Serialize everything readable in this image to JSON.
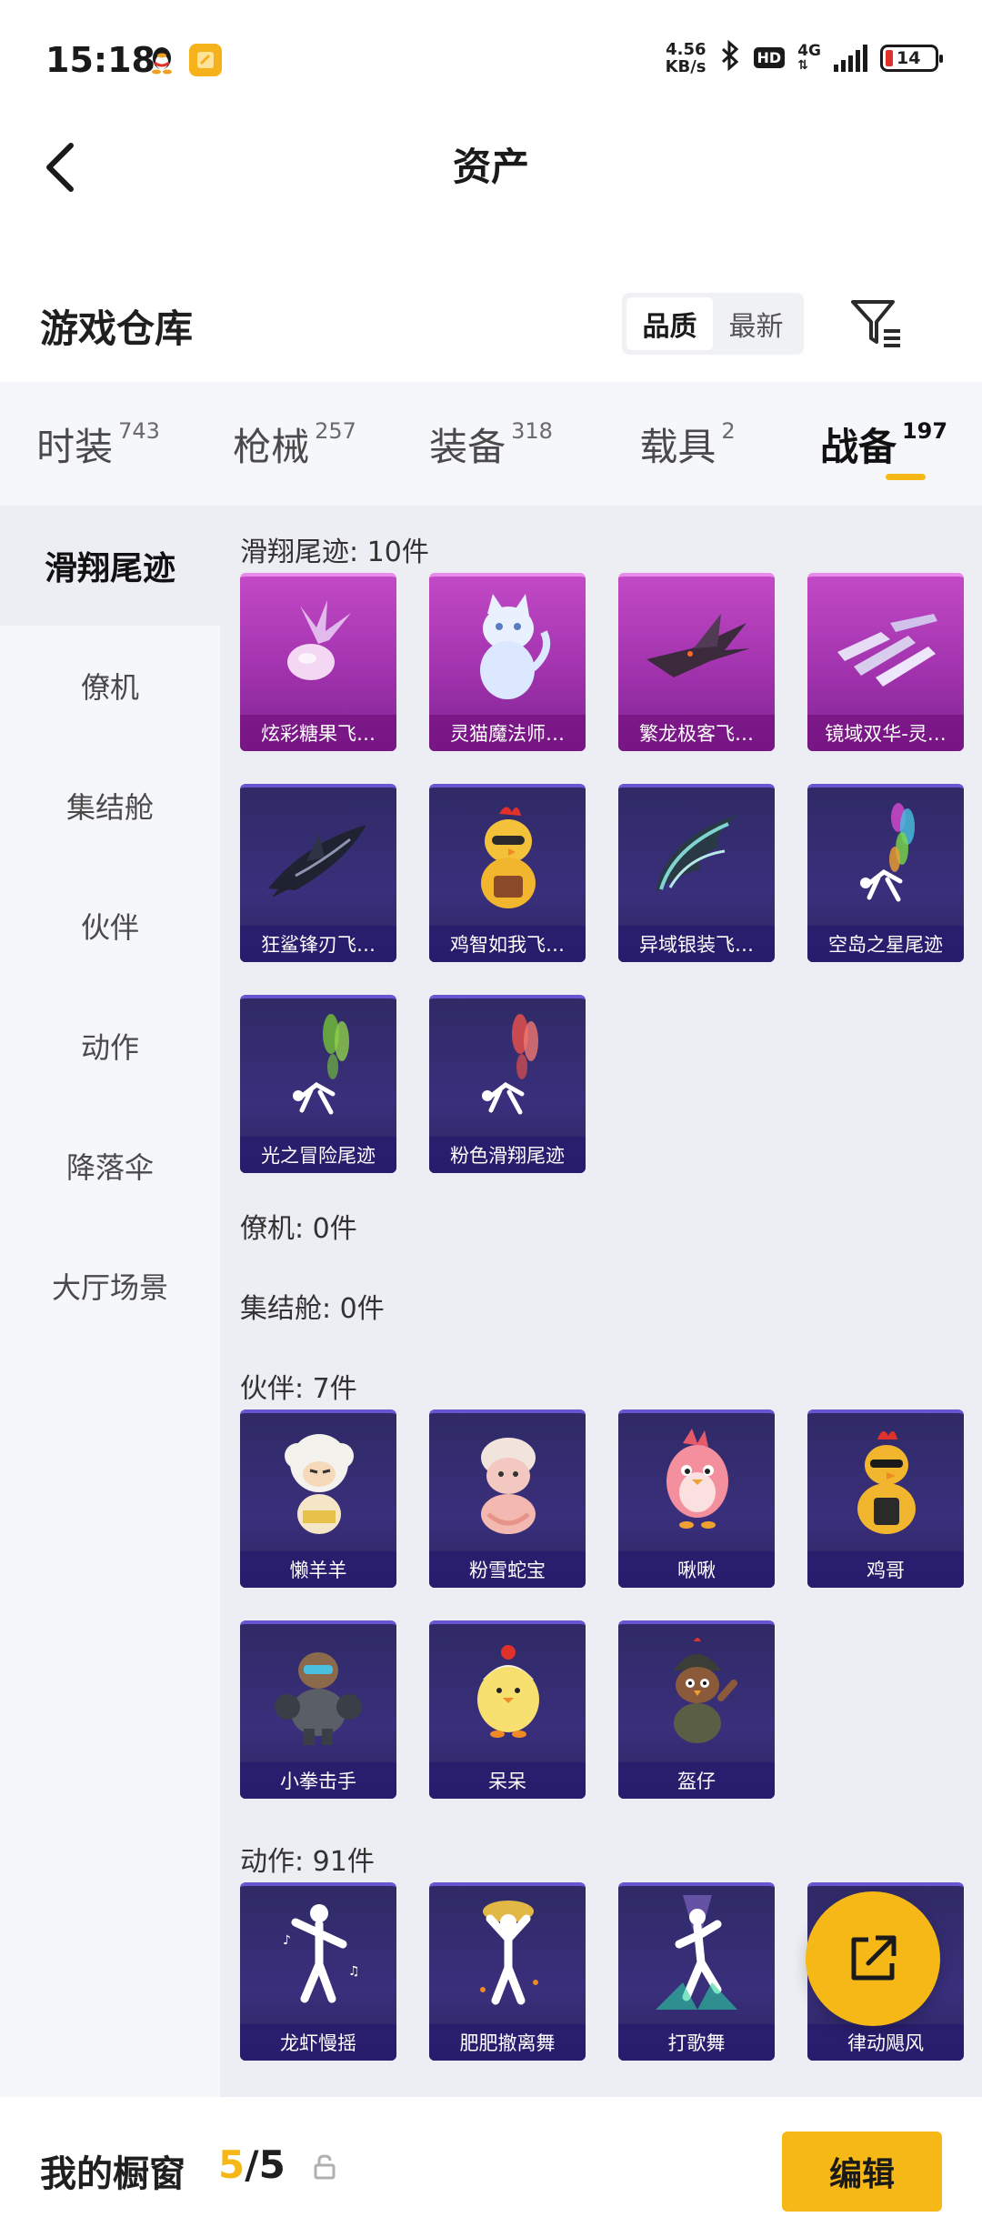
{
  "status_bar": {
    "time": "15:18",
    "net_speed_value": "4.56",
    "net_speed_unit": "KB/s",
    "network": "4G",
    "hd": "HD",
    "battery": "14"
  },
  "nav": {
    "title": "资产"
  },
  "section": {
    "title": "游戏仓库",
    "sort_options": [
      "品质",
      "最新"
    ],
    "active_sort": "品质"
  },
  "tabs": [
    {
      "label": "时装",
      "count": "743"
    },
    {
      "label": "枪械",
      "count": "257"
    },
    {
      "label": "装备",
      "count": "318"
    },
    {
      "label": "载具",
      "count": "2"
    },
    {
      "label": "战备",
      "count": "197"
    }
  ],
  "active_tab": "战备",
  "sidebar": [
    "滑翔尾迹",
    "僚机",
    "集结舱",
    "伙伴",
    "动作",
    "降落伞",
    "大厅场景"
  ],
  "active_sidebar": "滑翔尾迹",
  "groups": {
    "trails": {
      "title": "滑翔尾迹: 10件",
      "items": [
        {
          "name": "炫彩糖果飞…",
          "art": "candy-icon"
        },
        {
          "name": "灵猫魔法师…",
          "art": "cat-icon"
        },
        {
          "name": "繁龙极客飞…",
          "art": "dragon-icon"
        },
        {
          "name": "镜域双华-灵…",
          "art": "crystal-icon"
        },
        {
          "name": "狂鲨锋刃飞…",
          "art": "shark-icon"
        },
        {
          "name": "鸡智如我飞…",
          "art": "chicken-icon"
        },
        {
          "name": "异域银装飞…",
          "art": "wing-icon"
        },
        {
          "name": "空岛之星尾迹",
          "art": "rainbow-smoke-icon"
        },
        {
          "name": "光之冒险尾迹",
          "art": "green-smoke-icon"
        },
        {
          "name": "粉色滑翔尾迹",
          "art": "pink-smoke-icon"
        }
      ]
    },
    "wingman": {
      "title": "僚机: 0件"
    },
    "pod": {
      "title": "集结舱: 0件"
    },
    "partners": {
      "title": "伙伴: 7件",
      "items": [
        {
          "name": "懒羊羊",
          "art": "sheep-icon"
        },
        {
          "name": "粉雪蛇宝",
          "art": "snake-icon"
        },
        {
          "name": "啾啾",
          "art": "bird-icon"
        },
        {
          "name": "鸡哥",
          "art": "rooster-icon"
        },
        {
          "name": "小拳击手",
          "art": "boxer-icon"
        },
        {
          "name": "呆呆",
          "art": "chick-icon"
        },
        {
          "name": "盔仔",
          "art": "helmet-bird-icon"
        }
      ]
    },
    "emotes": {
      "title": "动作: 91件",
      "items": [
        {
          "name": "龙虾慢摇",
          "art": "dance-icon"
        },
        {
          "name": "肥肥撤离舞",
          "art": "dance-gold-icon"
        },
        {
          "name": "打歌舞",
          "art": "dance-stage-icon"
        },
        {
          "name": "律动飓风",
          "art": "dance-icon"
        }
      ]
    }
  },
  "bottom": {
    "title": "我的橱窗",
    "current": "5",
    "separator": "/",
    "total": "5",
    "edit_label": "编辑"
  },
  "colors": {
    "accent": "#f5b816",
    "card_blue": "#2f2a66",
    "card_purple": "#b23bb9"
  }
}
